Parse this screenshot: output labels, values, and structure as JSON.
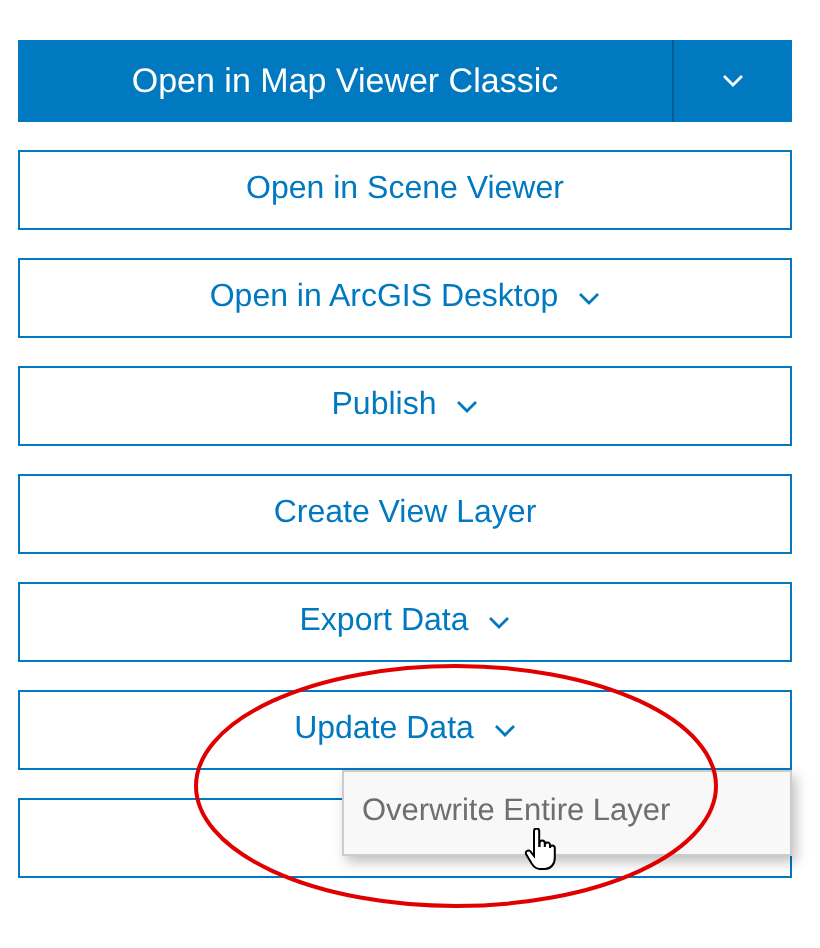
{
  "primary": {
    "label": "Open in Map Viewer Classic",
    "has_menu": true
  },
  "buttons": [
    {
      "kind": "button",
      "label": "Open in Scene Viewer",
      "caret": false
    },
    {
      "kind": "button",
      "label": "Open in ArcGIS Desktop",
      "caret": true
    },
    {
      "kind": "button",
      "label": "Publish",
      "caret": true
    },
    {
      "kind": "button",
      "label": "Create View Layer",
      "caret": false
    },
    {
      "kind": "button",
      "label": "Export Data",
      "caret": true
    },
    {
      "kind": "button",
      "label": "Update Data",
      "caret": true,
      "expanded": true,
      "menu_items": [
        {
          "label": "Overwrite Entire Layer"
        }
      ]
    },
    {
      "kind": "blank"
    }
  ],
  "annotation": {
    "kind": "ellipse"
  }
}
